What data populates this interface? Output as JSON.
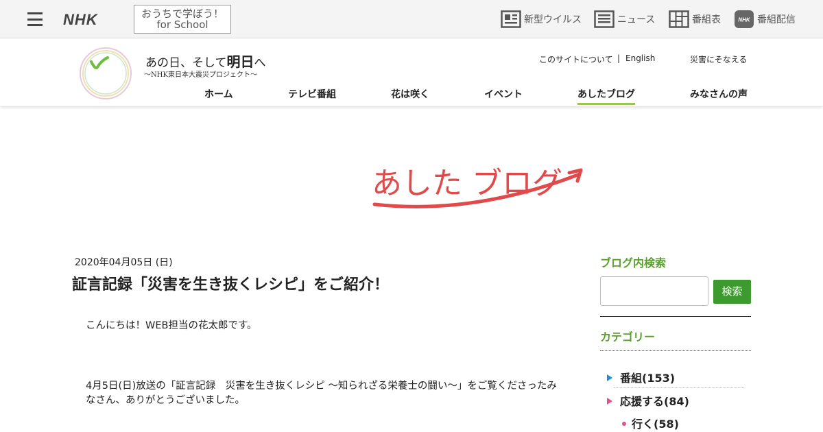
{
  "global_nav": {
    "logo": "NHK",
    "school_button": [
      "おうちで学ぼう！",
      "for School"
    ],
    "items": [
      {
        "label": "新型ウイルス",
        "icon": "virus-news-icon"
      },
      {
        "label": "ニュース",
        "icon": "news-icon"
      },
      {
        "label": "番組表",
        "icon": "schedule-grid-icon"
      },
      {
        "label": "番組配信",
        "icon": "nhk-plus-icon"
      }
    ]
  },
  "site": {
    "title_prefix": "あの日、そして",
    "title_emphasis": "明日",
    "title_suffix": "へ",
    "subtitle": "～NHK東日本大震災プロジェクト～",
    "util_links": [
      "このサイトについて",
      "English",
      "災害にそなえる"
    ],
    "separator": "|",
    "nav": [
      "ホーム",
      "テレビ番組",
      "花は咲く",
      "イベント",
      "あしたブログ",
      "みなさんの声"
    ],
    "active_nav": "あしたブログ"
  },
  "banner": {
    "text": "あした ブログ",
    "color": "#e04a4a"
  },
  "article": {
    "date": "2020年04月05日 (日)",
    "title": "証言記録「災害を生き抜くレシピ」をご紹介！",
    "paragraphs": [
      "こんにちは！WEB担当の花太郎です。",
      "4月5日(日)放送の「証言記録　災害を生き抜くレシピ ～知られざる栄養士の闘い～」をご覧くださったみなさん、ありがとうございました。"
    ]
  },
  "sidebar": {
    "search_heading": "ブログ内検索",
    "search_button": "検索",
    "search_value": "",
    "category_heading": "カテゴリー",
    "categories": [
      {
        "label": "番組(153)",
        "color": "#1f8fd6",
        "level": 1
      },
      {
        "label": "応援する(84)",
        "color": "#e0508f",
        "level": 1
      },
      {
        "label": "行く(58)",
        "color": "#e0508f",
        "level": 2
      }
    ]
  },
  "colors": {
    "accent_green": "#5aa02c",
    "search_button": "#3d9a2f",
    "nav_underline": "#9dc356"
  }
}
